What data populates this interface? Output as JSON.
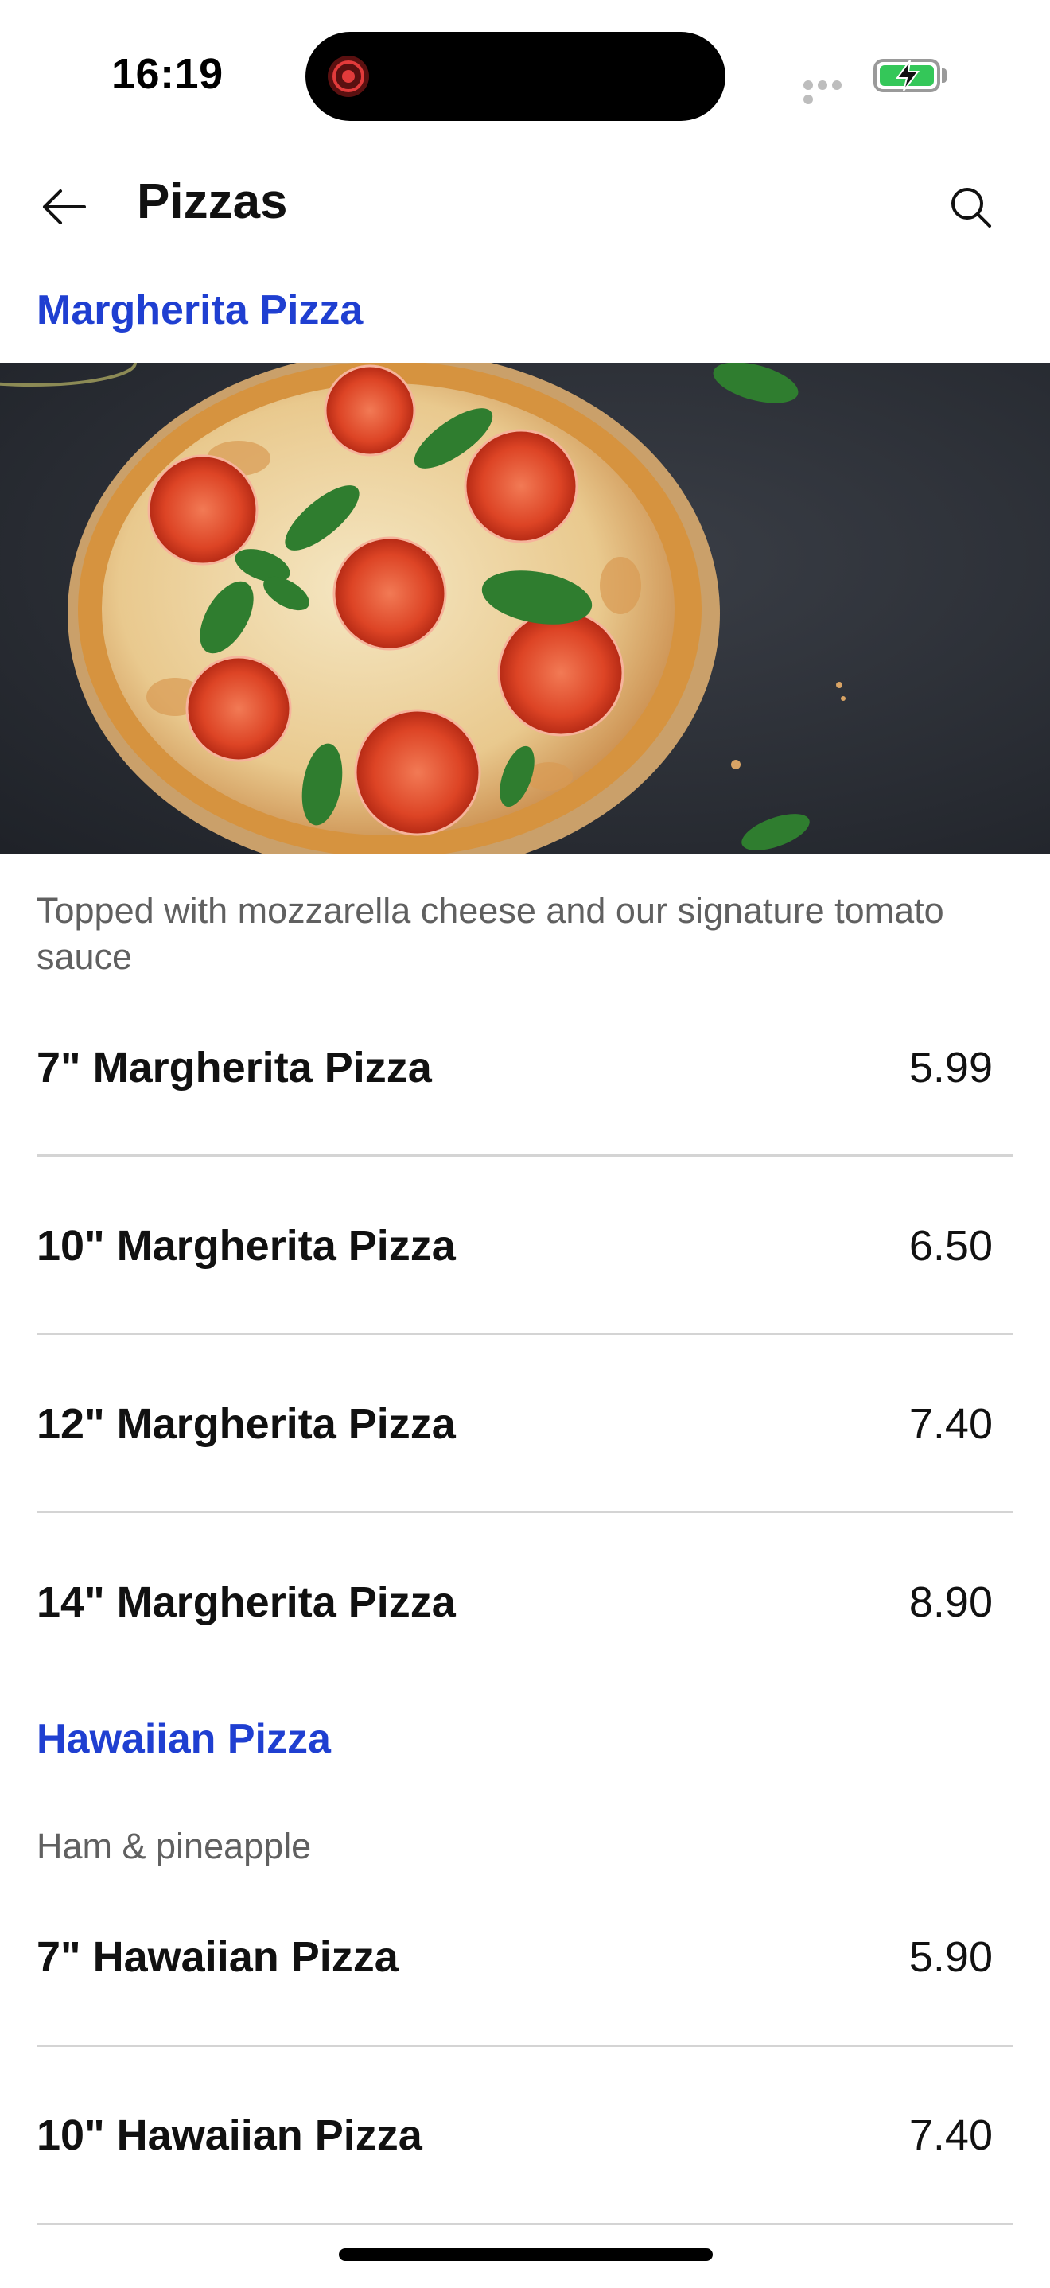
{
  "status_bar": {
    "time": "16:19"
  },
  "header": {
    "title": "Pizzas",
    "back_icon": "arrow-left-icon",
    "search_icon": "search-icon"
  },
  "sections": [
    {
      "title": "Margherita Pizza",
      "description": "Topped with mozzarella cheese and our signature tomato sauce",
      "items": [
        {
          "name": "7\" Margherita Pizza",
          "price": "5.99"
        },
        {
          "name": "10\" Margherita Pizza",
          "price": "6.50"
        },
        {
          "name": "12\" Margherita Pizza",
          "price": "7.40"
        },
        {
          "name": "14\" Margherita Pizza",
          "price": "8.90"
        }
      ]
    },
    {
      "title": "Hawaiian Pizza",
      "description": "Ham & pineapple",
      "items": [
        {
          "name": "7\" Hawaiian Pizza",
          "price": "5.90"
        },
        {
          "name": "10\" Hawaiian Pizza",
          "price": "7.40"
        }
      ]
    }
  ],
  "colors": {
    "section_heading": "#1f3fd1",
    "battery": "#34c759",
    "recording": "#e23b3b"
  }
}
